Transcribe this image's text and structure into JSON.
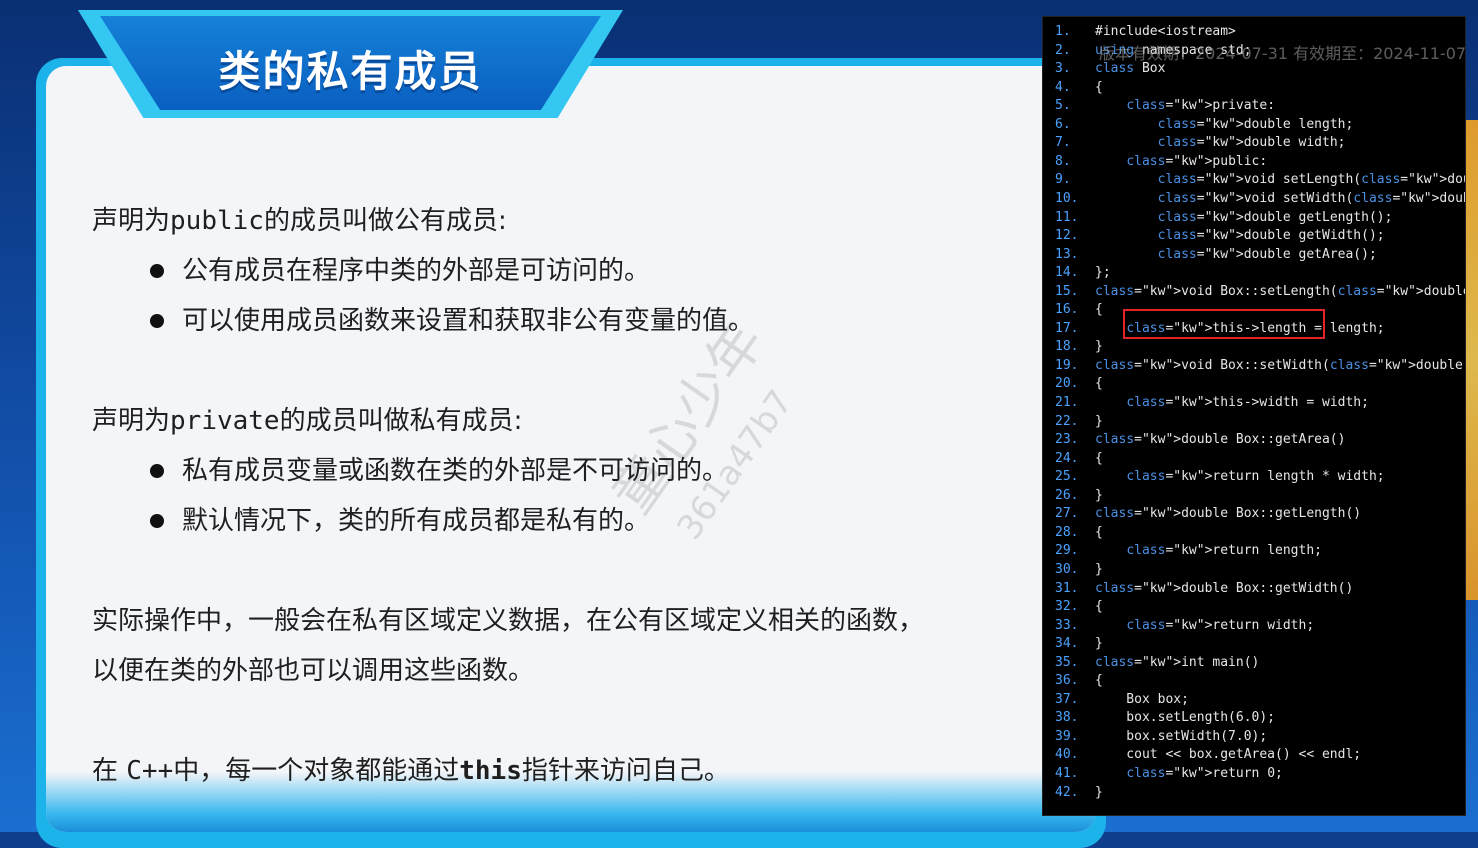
{
  "slide": {
    "title": "类的私有成员",
    "public_heading": {
      "prefix": "声明为",
      "keyword": "public",
      "suffix": "的成员叫做公有成员:"
    },
    "public_bullets": [
      "公有成员在程序中类的外部是可访问的。",
      "可以使用成员函数来设置和获取非公有变量的值。"
    ],
    "private_heading": {
      "prefix": "声明为",
      "keyword": "private",
      "suffix": "的成员叫做私有成员:"
    },
    "private_bullets": [
      "私有成员变量或函数在类的外部是不可访问的。",
      "默认情况下，类的所有成员都是私有的。"
    ],
    "practice_line1": "实际操作中，一般会在私有区域定义数据，在公有区域定义相关的函数，",
    "practice_line2": "以便在类的外部也可以调用这些函数。",
    "this_line": {
      "prefix": "在 ",
      "cpp": "C++",
      "middle": "中，每一个对象都能通过",
      "keyword": "this",
      "suffix": "指针来访问自己。"
    },
    "watermark": {
      "name": "童心少年",
      "code": "361a47b7"
    }
  },
  "code_panel": {
    "overlay_text": "版本有效期：2024-07-31 有效期至：2024-11-07",
    "highlight_color": "#e22424",
    "keyword_color": "#4a90e2",
    "line_number_color": "#4aa3ff",
    "lines": [
      {
        "n": "1.",
        "text": "#include<iostream>"
      },
      {
        "n": "2.",
        "text": "using namespace std;"
      },
      {
        "n": "3.",
        "text": "class Box"
      },
      {
        "n": "4.",
        "text": "{"
      },
      {
        "n": "5.",
        "text": "    private:"
      },
      {
        "n": "6.",
        "text": "        double length;"
      },
      {
        "n": "7.",
        "text": "        double width;"
      },
      {
        "n": "8.",
        "text": "    public:"
      },
      {
        "n": "9.",
        "text": "        void setLength(double length);"
      },
      {
        "n": "10.",
        "text": "        void setWidth(double width);"
      },
      {
        "n": "11.",
        "text": "        double getLength();"
      },
      {
        "n": "12.",
        "text": "        double getWidth();"
      },
      {
        "n": "13.",
        "text": "        double getArea();"
      },
      {
        "n": "14.",
        "text": "};"
      },
      {
        "n": "15.",
        "text": "void Box::setLength(double length)"
      },
      {
        "n": "16.",
        "text": "{"
      },
      {
        "n": "17.",
        "text": "    this->length = length;"
      },
      {
        "n": "18.",
        "text": "}"
      },
      {
        "n": "19.",
        "text": "void Box::setWidth(double width)"
      },
      {
        "n": "20.",
        "text": "{"
      },
      {
        "n": "21.",
        "text": "    this->width = width;"
      },
      {
        "n": "22.",
        "text": "}"
      },
      {
        "n": "23.",
        "text": "double Box::getArea()"
      },
      {
        "n": "24.",
        "text": "{"
      },
      {
        "n": "25.",
        "text": "    return length * width;"
      },
      {
        "n": "26.",
        "text": "}"
      },
      {
        "n": "27.",
        "text": "double Box::getLength()"
      },
      {
        "n": "28.",
        "text": "{"
      },
      {
        "n": "29.",
        "text": "    return length;"
      },
      {
        "n": "30.",
        "text": "}"
      },
      {
        "n": "31.",
        "text": "double Box::getWidth()"
      },
      {
        "n": "32.",
        "text": "{"
      },
      {
        "n": "33.",
        "text": "    return width;"
      },
      {
        "n": "34.",
        "text": "}"
      },
      {
        "n": "35.",
        "text": "int main()"
      },
      {
        "n": "36.",
        "text": "{"
      },
      {
        "n": "37.",
        "text": "    Box box;"
      },
      {
        "n": "38.",
        "text": "    box.setLength(6.0);"
      },
      {
        "n": "39.",
        "text": "    box.setWidth(7.0);"
      },
      {
        "n": "40.",
        "text": "    cout << box.getArea() << endl;"
      },
      {
        "n": "41.",
        "text": "    return 0;"
      },
      {
        "n": "42.",
        "text": "}"
      }
    ]
  }
}
